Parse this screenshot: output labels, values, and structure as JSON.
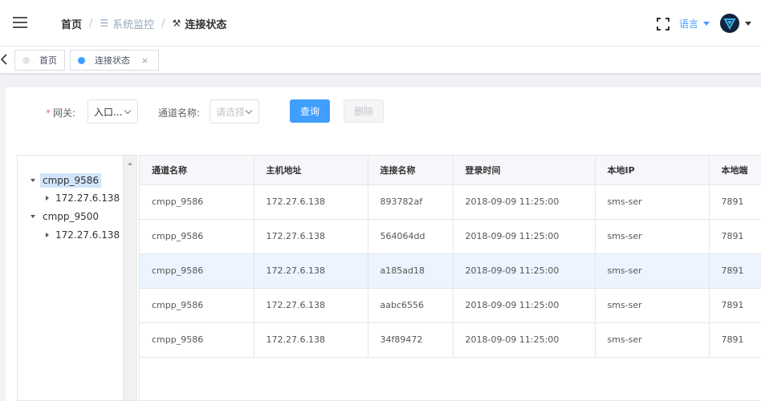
{
  "header": {
    "breadcrumb": {
      "home": "首页",
      "middle": "系统监控",
      "current": "连接状态"
    },
    "language": "语言"
  },
  "tags": [
    {
      "label": "首页"
    },
    {
      "label": "连接状态",
      "close": "×"
    }
  ],
  "filter": {
    "gateway_label": "网关:",
    "gateway_value": "入口...",
    "channel_label": "通道名称:",
    "channel_placeholder": "请选择",
    "query_button": "查询",
    "delete_button": "删除"
  },
  "tree": [
    {
      "label": "cmpp_9586",
      "child": "172.27.6.138"
    },
    {
      "label": "cmpp_9500",
      "child": "172.27.6.138"
    }
  ],
  "table": {
    "columns": [
      "通道名称",
      "主机地址",
      "连接名称",
      "登录时间",
      "本地IP",
      "本地端"
    ],
    "rows": [
      [
        "cmpp_9586",
        "172.27.6.138",
        "893782af",
        "2018-09-09 11:25:00",
        "sms-ser",
        "7891"
      ],
      [
        "cmpp_9586",
        "172.27.6.138",
        "564064dd",
        "2018-09-09 11:25:00",
        "sms-ser",
        "7891"
      ],
      [
        "cmpp_9586",
        "172.27.6.138",
        "a185ad18",
        "2018-09-09 11:25:00",
        "sms-ser",
        "7891"
      ],
      [
        "cmpp_9586",
        "172.27.6.138",
        "aabc6556",
        "2018-09-09 11:25:00",
        "sms-ser",
        "7891"
      ],
      [
        "cmpp_9586",
        "172.27.6.138",
        "34f89472",
        "2018-09-09 11:25:00",
        "sms-ser",
        "7891"
      ]
    ],
    "highlighted_row": 2
  },
  "colors": {
    "primary": "#409eff",
    "required": "#f56c6c",
    "selected_row": "#ecf5ff"
  },
  "icons": [
    "hamburger-icon",
    "layers-icon",
    "wrench-icon",
    "fullscreen-icon",
    "caret-down-icon",
    "avatar-logo",
    "chevron-left-icon",
    "close-icon",
    "tree-expand-icon",
    "tree-leaf-icon"
  ]
}
